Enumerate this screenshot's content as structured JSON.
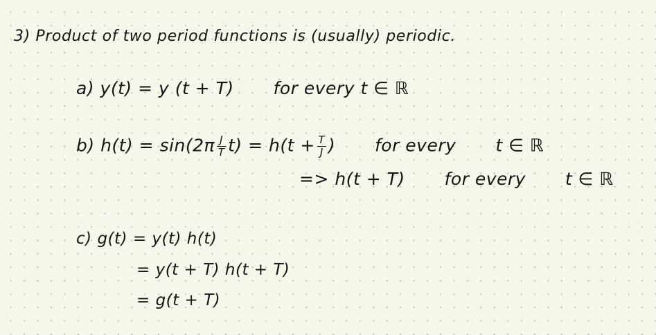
{
  "title": "3) Product of two period functions is (usually) periodic.",
  "part_a": {
    "label": "a)",
    "equation": "y(t) = y (t + T)",
    "condition": "for every",
    "domain": "t ∈ ℝ"
  },
  "part_b": {
    "label": "b)",
    "lhs": "h(t) = sin(2π",
    "frac1_num": "J",
    "frac1_den": "T",
    "mid": "t) = h(t +",
    "frac2_num": "T",
    "frac2_den": "J",
    "rhs_close": ")",
    "condition": "for every",
    "domain": "t ∈ ℝ",
    "implies": "=> h(t + T)",
    "condition2": "for every",
    "domain2": "t ∈ ℝ"
  },
  "part_c": {
    "label": "c)",
    "line1": "g(t) = y(t) h(t)",
    "line2": "= y(t + T) h(t + T)",
    "line3": "= g(t + T)"
  }
}
